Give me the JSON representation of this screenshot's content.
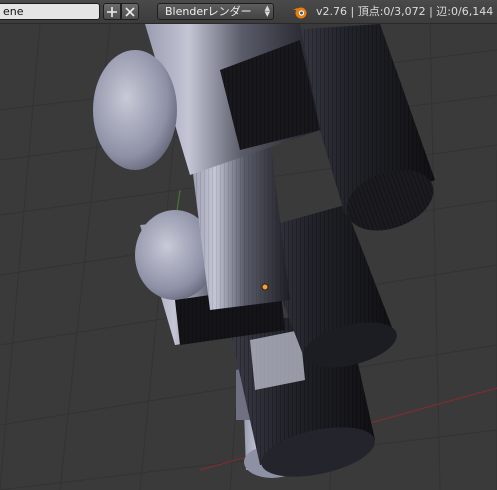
{
  "header": {
    "scene_name": "ene",
    "render_engine": "Blenderレンダー",
    "stats": "v2.76 | 頂点:0/3,072 | 辺:0/6,144 |"
  },
  "icons": {
    "add": "plus-icon",
    "remove": "x-icon",
    "dropdown": "up-down-arrows-icon",
    "logo": "blender-logo-icon"
  },
  "colors": {
    "viewport_bg": "#3a3a3a",
    "grid": "#333333",
    "x_axis": "#7a2e2e",
    "y_axis": "#3f7a2a",
    "object_origin": "#f0a040",
    "mesh_light": "#b4b7cc",
    "mesh_dark": "#1c1c22"
  }
}
